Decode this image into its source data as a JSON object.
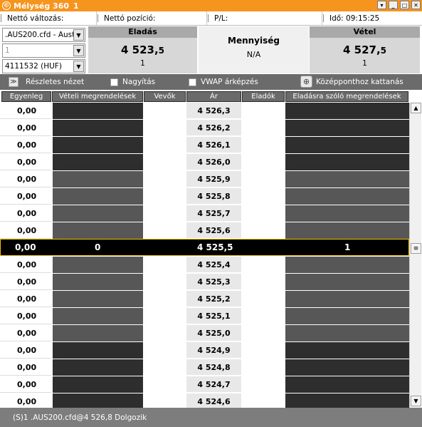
{
  "window": {
    "title": "Mélység 360",
    "tab_no": "1"
  },
  "info": {
    "netto_valtozas": "Nettó változás:",
    "netto_pozicio": "Nettó pozíció:",
    "pl": "P/L:",
    "ido": "Idő: 09:15:25"
  },
  "controls": {
    "instrument": ".AUS200.cfd - Aust",
    "quantity": "1",
    "account": "4111532 (HUF)"
  },
  "sell_box": {
    "label": "Eladás",
    "price_main": "4 523,",
    "price_dec": "5",
    "qty": "1"
  },
  "qty_box": {
    "label": "Mennyiség",
    "value": "N/A"
  },
  "buy_box": {
    "label": "Vétel",
    "price_main": "4 527,",
    "price_dec": "5",
    "qty": "1"
  },
  "toolbar": {
    "detailed": "Részletes nézet",
    "zoom": "Nagyítás",
    "vwap": "VWAP árképzés",
    "center": "Középponthoz kattanás"
  },
  "columns": {
    "egyenleg": "Egyenleg",
    "veteli": "Vételi megrendelések",
    "vevok": "Vevők",
    "ar": "Ár",
    "eladok": "Eladók",
    "eladasra": "Eladásra szóló megrendelések"
  },
  "rows_above": [
    {
      "egyenleg": "0,00",
      "price": "4 526,3"
    },
    {
      "egyenleg": "0,00",
      "price": "4 526,2"
    },
    {
      "egyenleg": "0,00",
      "price": "4 526,1"
    },
    {
      "egyenleg": "0,00",
      "price": "4 526,0"
    },
    {
      "egyenleg": "0,00",
      "price": "4 525,9"
    },
    {
      "egyenleg": "0,00",
      "price": "4 525,8"
    },
    {
      "egyenleg": "0,00",
      "price": "4 525,7"
    },
    {
      "egyenleg": "0,00",
      "price": "4 525,6"
    }
  ],
  "mid_row": {
    "egyenleg": "0,00",
    "buy_orders": "0",
    "price": "4 525,5",
    "sell_orders": "1"
  },
  "rows_below": [
    {
      "egyenleg": "0,00",
      "price": "4 525,4"
    },
    {
      "egyenleg": "0,00",
      "price": "4 525,3"
    },
    {
      "egyenleg": "0,00",
      "price": "4 525,2"
    },
    {
      "egyenleg": "0,00",
      "price": "4 525,1"
    },
    {
      "egyenleg": "0,00",
      "price": "4 525,0"
    },
    {
      "egyenleg": "0,00",
      "price": "4 524,9"
    },
    {
      "egyenleg": "0,00",
      "price": "4 524,8"
    },
    {
      "egyenleg": "0,00",
      "price": "4 524,7"
    },
    {
      "egyenleg": "0,00",
      "price": "4 524,6"
    }
  ],
  "status": {
    "text": "(S)1 .AUS200.cfd@4 526,8 Dolgozik"
  },
  "colors": {
    "title": "#f7941d",
    "band_dark": "#2e2e2e",
    "band_mid": "#575757",
    "highlight": "#f0c000"
  }
}
